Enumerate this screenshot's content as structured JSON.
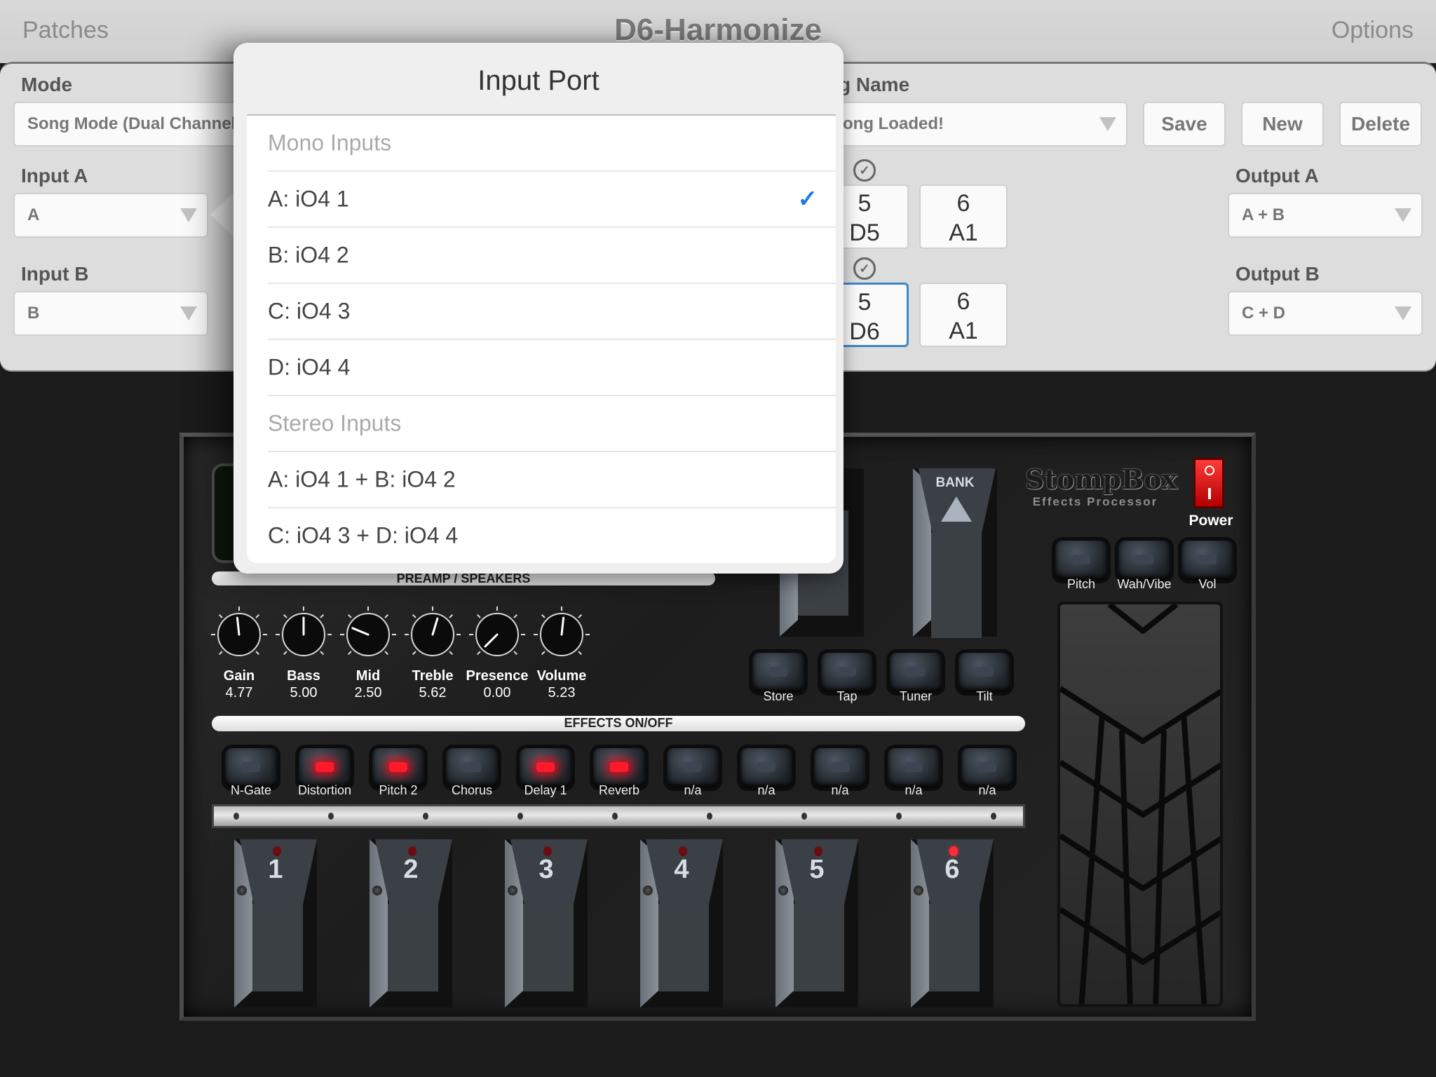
{
  "header": {
    "left_button": "Patches",
    "title": "D6-Harmonize",
    "right_button": "Options"
  },
  "settings": {
    "mode": {
      "label": "Mode",
      "value": "Song Mode (Dual Channel"
    },
    "input_a": {
      "label": "Input A",
      "value": "A"
    },
    "input_b": {
      "label": "Input B",
      "value": "B"
    },
    "song_name": {
      "label": "g Name",
      "value": "ong Loaded!"
    },
    "buttons": {
      "save": "Save",
      "new": "New",
      "delete": "Delete"
    },
    "slots_row_a": [
      {
        "num": "5",
        "patch": "D5",
        "selected": false
      },
      {
        "num": "6",
        "patch": "A1",
        "selected": false
      }
    ],
    "slots_row_b": [
      {
        "num": "5",
        "patch": "D6",
        "selected": true
      },
      {
        "num": "6",
        "patch": "A1",
        "selected": false
      }
    ],
    "output_a": {
      "label": "Output A",
      "value": "A + B"
    },
    "output_b": {
      "label": "Output B",
      "value": "C + D"
    }
  },
  "popover": {
    "title": "Input Port",
    "sections": [
      {
        "header": "Mono Inputs",
        "items": [
          {
            "label": "A: iO4 1",
            "checked": true
          },
          {
            "label": "B: iO4 2",
            "checked": false
          },
          {
            "label": "C: iO4 3",
            "checked": false
          },
          {
            "label": "D: iO4 4",
            "checked": false
          }
        ]
      },
      {
        "header": "Stereo Inputs",
        "items": [
          {
            "label": "A: iO4 1 + B: iO4 2",
            "checked": false
          },
          {
            "label": "C: iO4 3 + D: iO4 4",
            "checked": false
          }
        ]
      }
    ],
    "check_glyph": "✓"
  },
  "stompbox": {
    "preamp_label": "PREAMP / SPEAKERS",
    "knobs": [
      {
        "name": "Gain",
        "value": "4.77"
      },
      {
        "name": "Bass",
        "value": "5.00"
      },
      {
        "name": "Mid",
        "value": "2.50"
      },
      {
        "name": "Treble",
        "value": "5.62"
      },
      {
        "name": "Presence",
        "value": "0.00"
      },
      {
        "name": "Volume",
        "value": "5.23"
      }
    ],
    "effects_label": "EFFECTS ON/OFF",
    "effects": [
      {
        "name": "N-Gate",
        "on": false
      },
      {
        "name": "Distortion",
        "on": true
      },
      {
        "name": "Pitch 2",
        "on": true
      },
      {
        "name": "Chorus",
        "on": false
      },
      {
        "name": "Delay 1",
        "on": true
      },
      {
        "name": "Reverb",
        "on": true
      },
      {
        "name": "n/a",
        "on": false
      },
      {
        "name": "n/a",
        "on": false
      },
      {
        "name": "n/a",
        "on": false
      },
      {
        "name": "n/a",
        "on": false
      },
      {
        "name": "n/a",
        "on": false
      }
    ],
    "function_buttons": [
      "Store",
      "Tap",
      "Tuner",
      "Tilt"
    ],
    "pedal_buttons": [
      "Pitch",
      "Wah/Vibe",
      "Vol"
    ],
    "bank_label": "BANK",
    "brand": "StompBox",
    "brand_sub": "Effects Processor",
    "power_label": "Power",
    "footswitches": [
      {
        "num": "1",
        "active": false
      },
      {
        "num": "2",
        "active": false
      },
      {
        "num": "3",
        "active": false
      },
      {
        "num": "4",
        "active": false
      },
      {
        "num": "5",
        "active": false
      },
      {
        "num": "6",
        "active": true
      }
    ],
    "colors": {
      "led_on": "#ff1a2a",
      "selection": "#1a7ae8"
    }
  }
}
